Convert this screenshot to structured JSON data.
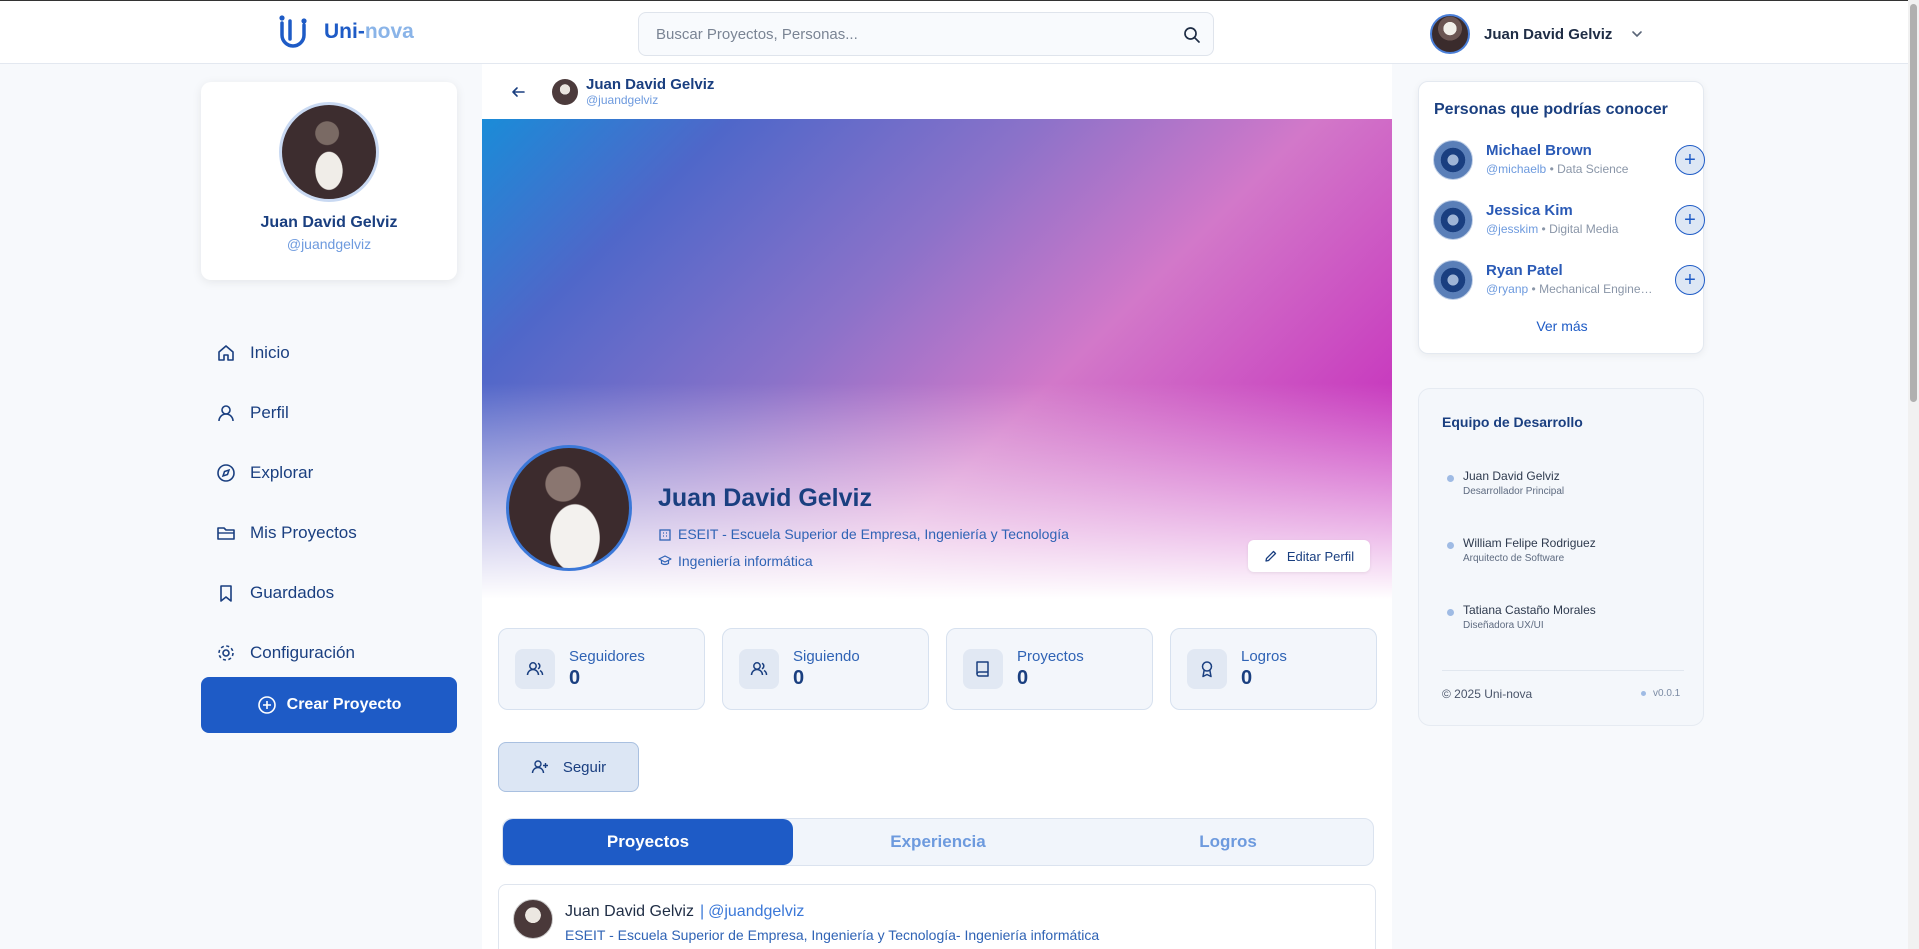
{
  "header": {
    "brand_part1": "Uni-",
    "brand_part2": "nova",
    "search_placeholder": "Buscar Proyectos, Personas...",
    "user_name": "Juan David Gelviz"
  },
  "sidebar": {
    "name": "Juan David Gelviz",
    "handle": "@juandgelviz",
    "items": [
      {
        "label": "Inicio",
        "icon": "home-icon"
      },
      {
        "label": "Perfil",
        "icon": "user-icon"
      },
      {
        "label": "Explorar",
        "icon": "compass-icon"
      },
      {
        "label": "Mis Proyectos",
        "icon": "folder-icon"
      },
      {
        "label": "Guardados",
        "icon": "bookmark-icon"
      },
      {
        "label": "Configuración",
        "icon": "gear-icon"
      }
    ],
    "create_button": "Crear Proyecto"
  },
  "profile": {
    "header_name": "Juan David Gelviz",
    "header_handle": "@juandgelviz",
    "name": "Juan David Gelviz",
    "institution": "ESEIT - Escuela Superior de Empresa, Ingeniería y Tecnología",
    "program": "Ingeniería informática",
    "edit_button": "Editar Perfil",
    "stats": [
      {
        "label": "Seguidores",
        "value": "0",
        "icon": "users-icon"
      },
      {
        "label": "Siguiendo",
        "value": "0",
        "icon": "users-icon"
      },
      {
        "label": "Proyectos",
        "value": "0",
        "icon": "book-icon"
      },
      {
        "label": "Logros",
        "value": "0",
        "icon": "award-icon"
      }
    ],
    "follow_button": "Seguir",
    "tabs": [
      "Proyectos",
      "Experiencia",
      "Logros"
    ],
    "active_tab": "Proyectos"
  },
  "post": {
    "name": "Juan David Gelviz",
    "separator": "|",
    "handle": "@juandgelviz",
    "subtitle": "ESEIT - Escuela Superior de Empresa, Ingeniería y Tecnología- Ingeniería informática"
  },
  "suggestions": {
    "title": "Personas que podrías conocer",
    "people": [
      {
        "name": "Michael Brown",
        "handle": "@michaelb",
        "field": "Data Science"
      },
      {
        "name": "Jessica Kim",
        "handle": "@jesskim",
        "field": "Digital Media"
      },
      {
        "name": "Ryan Patel",
        "handle": "@ryanp",
        "field": "Mechanical Engineering"
      }
    ],
    "bullet": "•",
    "more": "Ver más"
  },
  "team": {
    "title": "Equipo de Desarrollo",
    "members": [
      {
        "name": "Juan David Gelviz",
        "role": "Desarrollador Principal"
      },
      {
        "name": "William Felipe Rodriguez",
        "role": "Arquitecto de Software"
      },
      {
        "name": "Tatiana Castaño Morales",
        "role": "Diseñadora UX/UI"
      }
    ],
    "copyright": "© 2025 Uni-nova",
    "version": "v0.0.1"
  },
  "colors": {
    "primary": "#1e5bc6",
    "text_dark_blue": "#1a3f80",
    "accent_light": "#8ab4e8"
  }
}
